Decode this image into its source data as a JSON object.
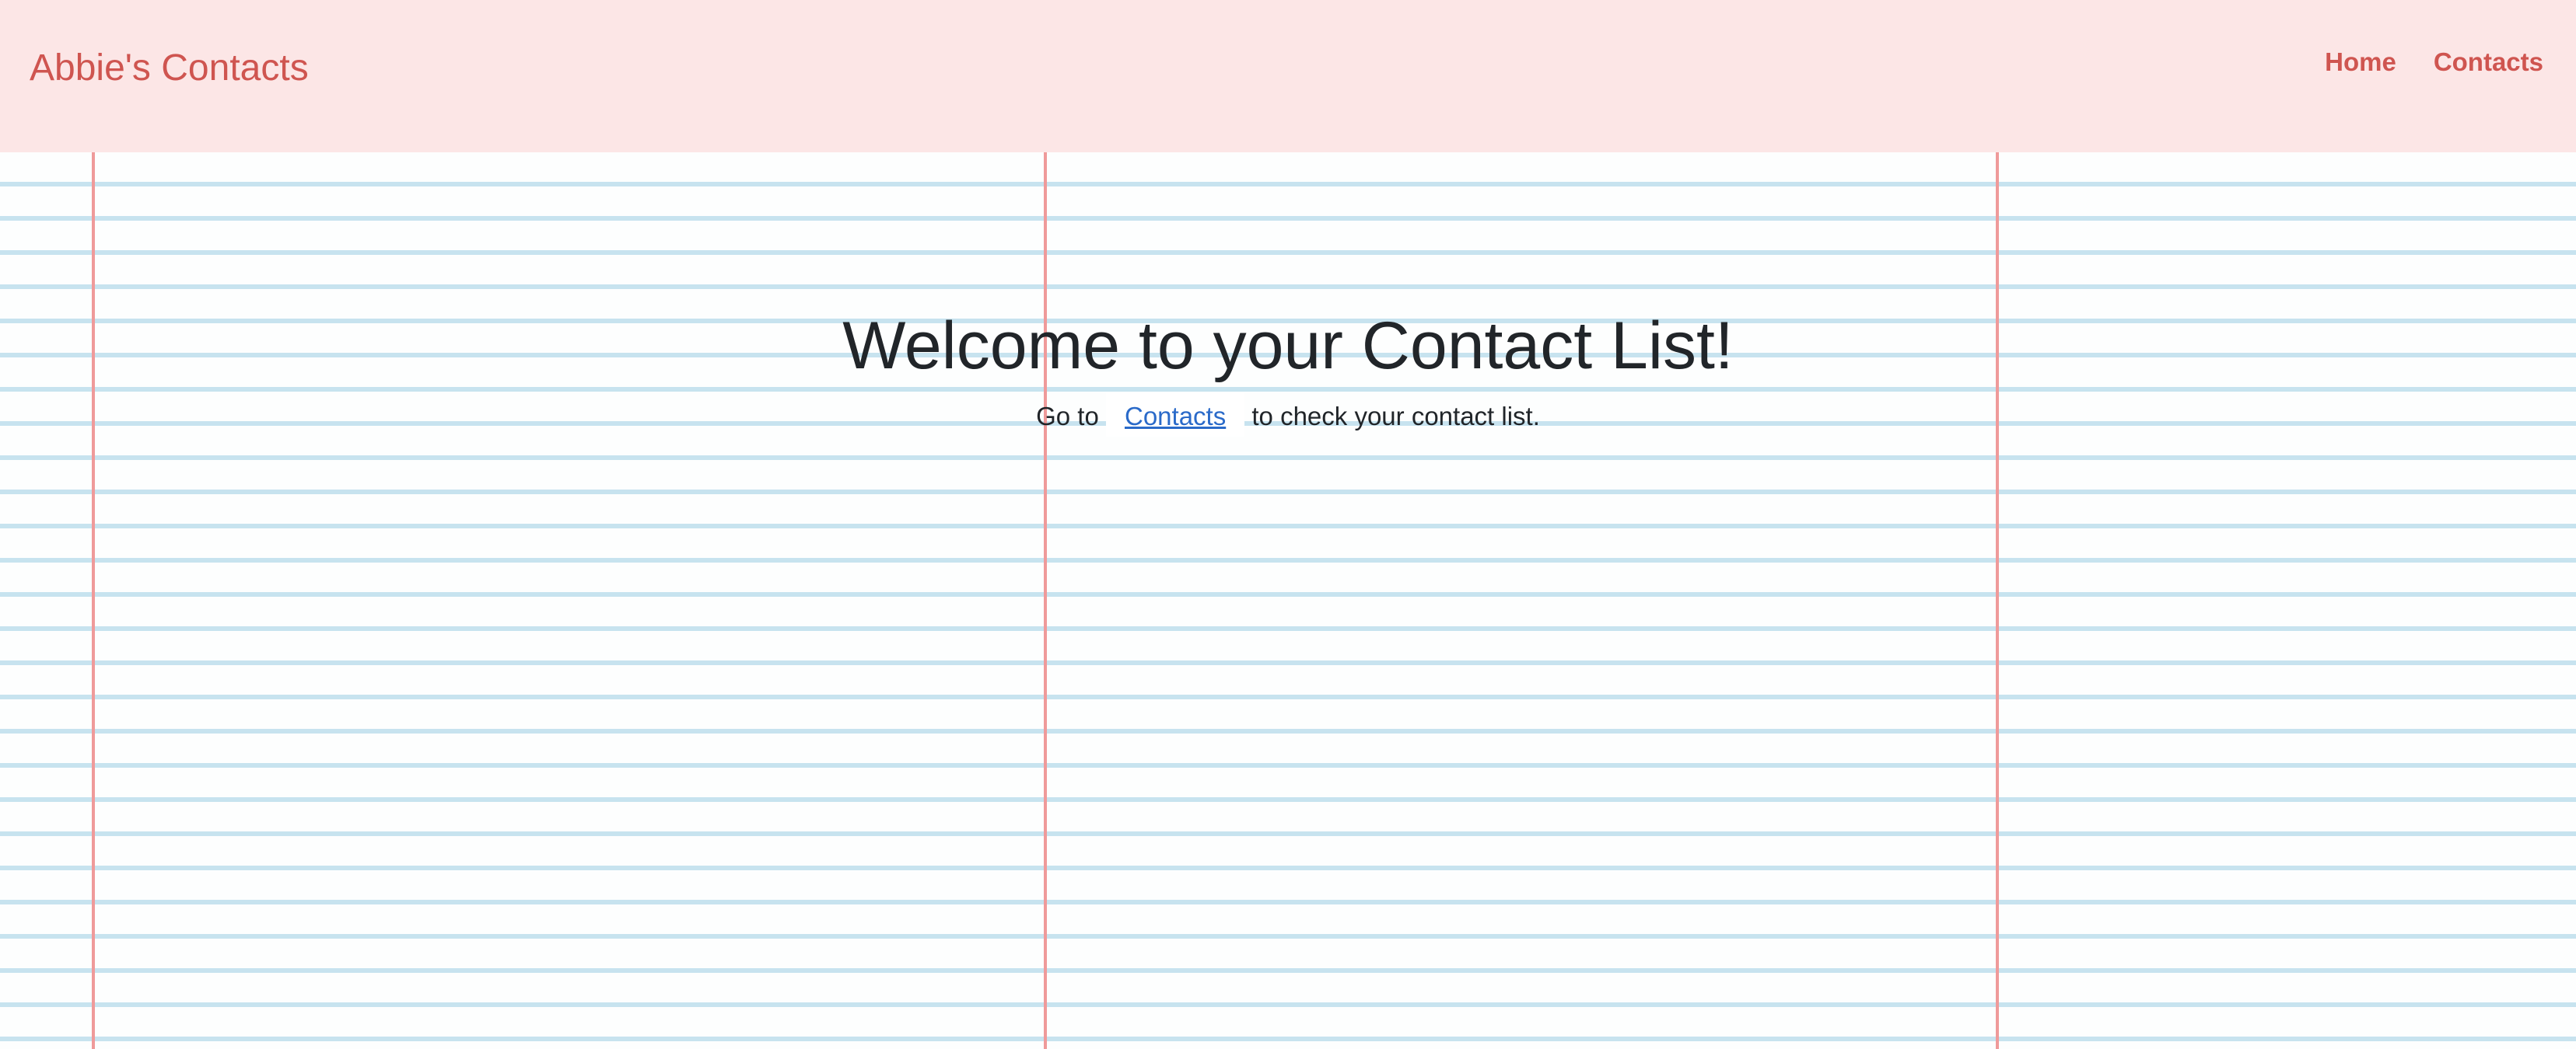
{
  "header": {
    "brand": "Abbie's Contacts",
    "nav": [
      {
        "label": "Home"
      },
      {
        "label": "Contacts"
      }
    ]
  },
  "main": {
    "title": "Welcome to your Contact List!",
    "subtitle_prefix": "Go to",
    "subtitle_link": "Contacts",
    "subtitle_suffix": "to check your contact list."
  },
  "colors": {
    "header_bg": "#fce6e6",
    "accent": "#cf5550",
    "link": "#2a6ac9",
    "ruled_line": "#c7e3ef",
    "margin_line": "#ef9a9a",
    "text": "#212529"
  }
}
